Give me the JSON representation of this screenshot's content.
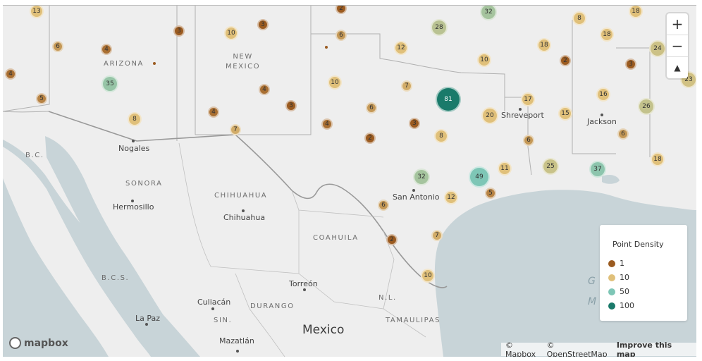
{
  "colors": {
    "c1": "#9b5b20",
    "c10": "#e0c07a",
    "c50": "#7ec6b6",
    "c100": "#1a7a6a",
    "land": "#eeeeee",
    "water": "#c8d4d8",
    "border": "#b0b0b0"
  },
  "labels": {
    "arizona": "ARIZONA",
    "new_mexico": "NEW\nMEXICO",
    "sonora": "SONORA",
    "chihuahua_state": "CHIHUAHUA",
    "coahuila": "COAHUILA",
    "durango": "DURANGO",
    "tamaulipas": "TAMAULIPAS",
    "sin": "SIN.",
    "nl": "N.L.",
    "bc": "B.C.",
    "bcs": "B.C.S.",
    "mexico": "Mexico",
    "gulf_partial_1": "G",
    "gulf_partial_2": "M"
  },
  "cities": {
    "nogales": "Nogales",
    "hermosillo": "Hermosillo",
    "chihuahua": "Chihuahua",
    "torreon": "Torreón",
    "culiacan": "Culiacán",
    "la_paz": "La Paz",
    "mazatlan": "Mazatlán",
    "san_antonio": "San Antonio",
    "shreveport": "Shreveport",
    "jackson": "Jackson"
  },
  "clusters": [
    {
      "id": "c01",
      "count": "13"
    },
    {
      "id": "c02",
      "count": "6"
    },
    {
      "id": "c03",
      "count": "4"
    },
    {
      "id": "c04",
      "count": "4"
    },
    {
      "id": "c05",
      "count": "35"
    },
    {
      "id": "c06",
      "count": "5"
    },
    {
      "id": "c07",
      "count": "8"
    },
    {
      "id": "c08",
      "count": "3"
    },
    {
      "id": "c09",
      "count": "10"
    },
    {
      "id": "c10",
      "count": "3"
    },
    {
      "id": "c11",
      "count": "6"
    },
    {
      "id": "c12",
      "count": "4"
    },
    {
      "id": "c13",
      "count": "3"
    },
    {
      "id": "c14",
      "count": "4"
    },
    {
      "id": "c15",
      "count": "7"
    },
    {
      "id": "c16",
      "count": "10"
    },
    {
      "id": "c17",
      "count": "4"
    },
    {
      "id": "c18",
      "count": "2"
    },
    {
      "id": "c19",
      "count": "12"
    },
    {
      "id": "c20",
      "count": "28"
    },
    {
      "id": "c21",
      "count": "32"
    },
    {
      "id": "c22",
      "count": "10"
    },
    {
      "id": "c23",
      "count": "7"
    },
    {
      "id": "c24",
      "count": "6"
    },
    {
      "id": "c25",
      "count": "81"
    },
    {
      "id": "c26",
      "count": "3"
    },
    {
      "id": "c27",
      "count": "2"
    },
    {
      "id": "c28",
      "count": "8"
    },
    {
      "id": "c29",
      "count": "17"
    },
    {
      "id": "c30",
      "count": "20"
    },
    {
      "id": "c31",
      "count": "8"
    },
    {
      "id": "c32",
      "count": "18"
    },
    {
      "id": "c33",
      "count": "2"
    },
    {
      "id": "c34",
      "count": "18"
    },
    {
      "id": "c35",
      "count": "18"
    },
    {
      "id": "c36",
      "count": "24"
    },
    {
      "id": "c37",
      "count": "3"
    },
    {
      "id": "c38",
      "count": "23"
    },
    {
      "id": "c39",
      "count": "16"
    },
    {
      "id": "c40",
      "count": "15"
    },
    {
      "id": "c41",
      "count": "26"
    },
    {
      "id": "c42",
      "count": "6"
    },
    {
      "id": "c43",
      "count": "6"
    },
    {
      "id": "c44",
      "count": "18"
    },
    {
      "id": "c45",
      "count": "25"
    },
    {
      "id": "c46",
      "count": "37"
    },
    {
      "id": "c47",
      "count": "11"
    },
    {
      "id": "c48",
      "count": "49"
    },
    {
      "id": "c49",
      "count": "5"
    },
    {
      "id": "c50",
      "count": "32"
    },
    {
      "id": "c51",
      "count": "12"
    },
    {
      "id": "c52",
      "count": "6"
    },
    {
      "id": "c53",
      "count": "2"
    },
    {
      "id": "c54",
      "count": "7"
    },
    {
      "id": "c55",
      "count": "10"
    }
  ],
  "zoom": {
    "zoom_in": "+",
    "zoom_out": "−",
    "compass": "▲"
  },
  "legend": {
    "title": "Point Density",
    "items": [
      {
        "label": "1"
      },
      {
        "label": "10"
      },
      {
        "label": "50"
      },
      {
        "label": "100"
      }
    ]
  },
  "logo": {
    "text": "mapbox"
  },
  "attribution": {
    "mapbox": "© Mapbox",
    "osm": "© OpenStreetMap",
    "improve": "Improve this map"
  }
}
